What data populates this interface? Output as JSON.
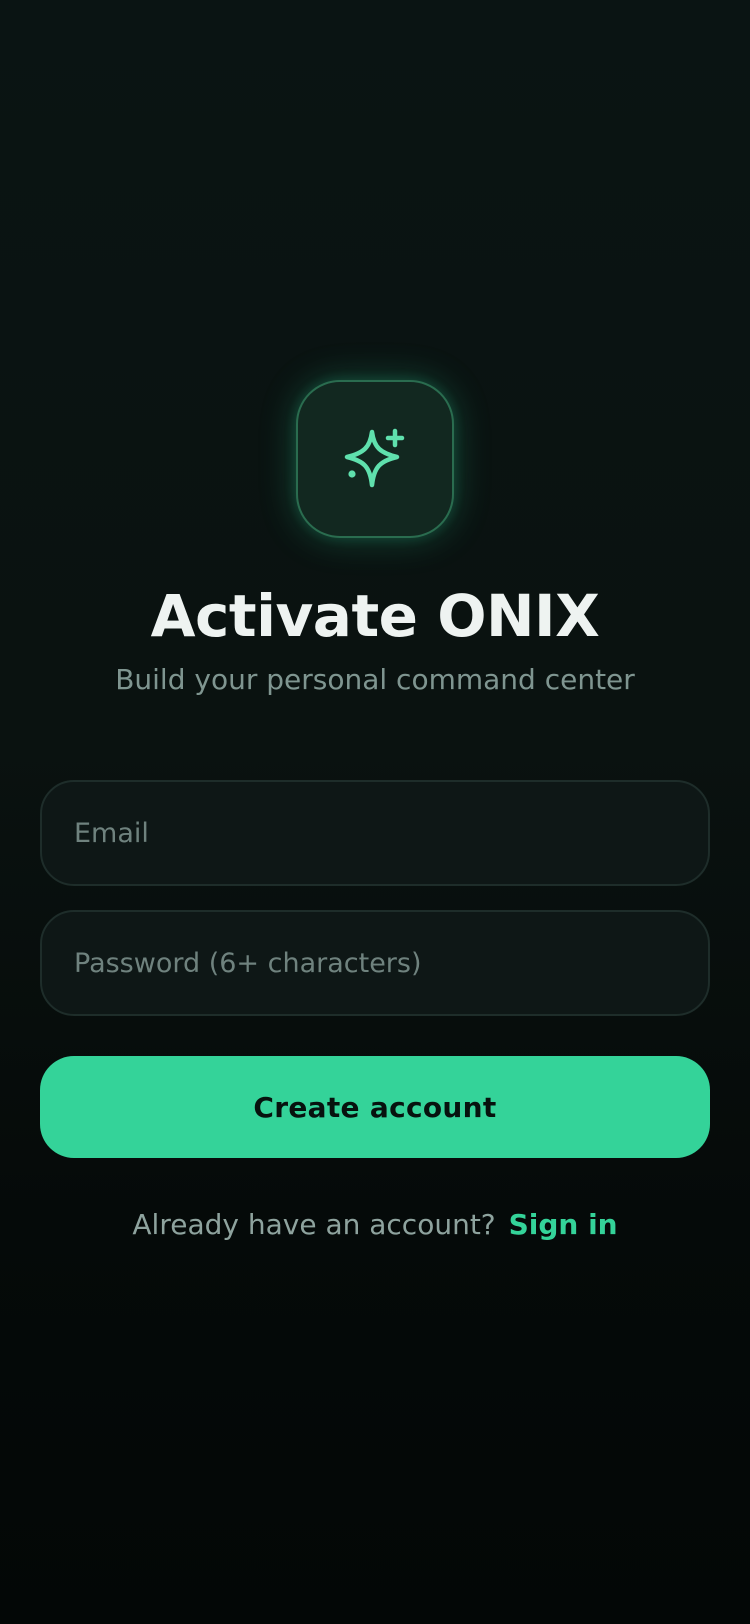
{
  "colors": {
    "accent": "#34d399",
    "background": "#0a1210",
    "tile_border": "#2a6c4f"
  },
  "logo": {
    "icon": "sparkle-icon"
  },
  "header": {
    "title": "Activate ONIX",
    "subtitle": "Build your personal command center"
  },
  "form": {
    "email": {
      "value": "",
      "placeholder": "Email"
    },
    "password": {
      "value": "",
      "placeholder": "Password (6+ characters)"
    },
    "submit_label": "Create account"
  },
  "footer": {
    "prompt": "Already have an account?",
    "link_label": "Sign in"
  }
}
